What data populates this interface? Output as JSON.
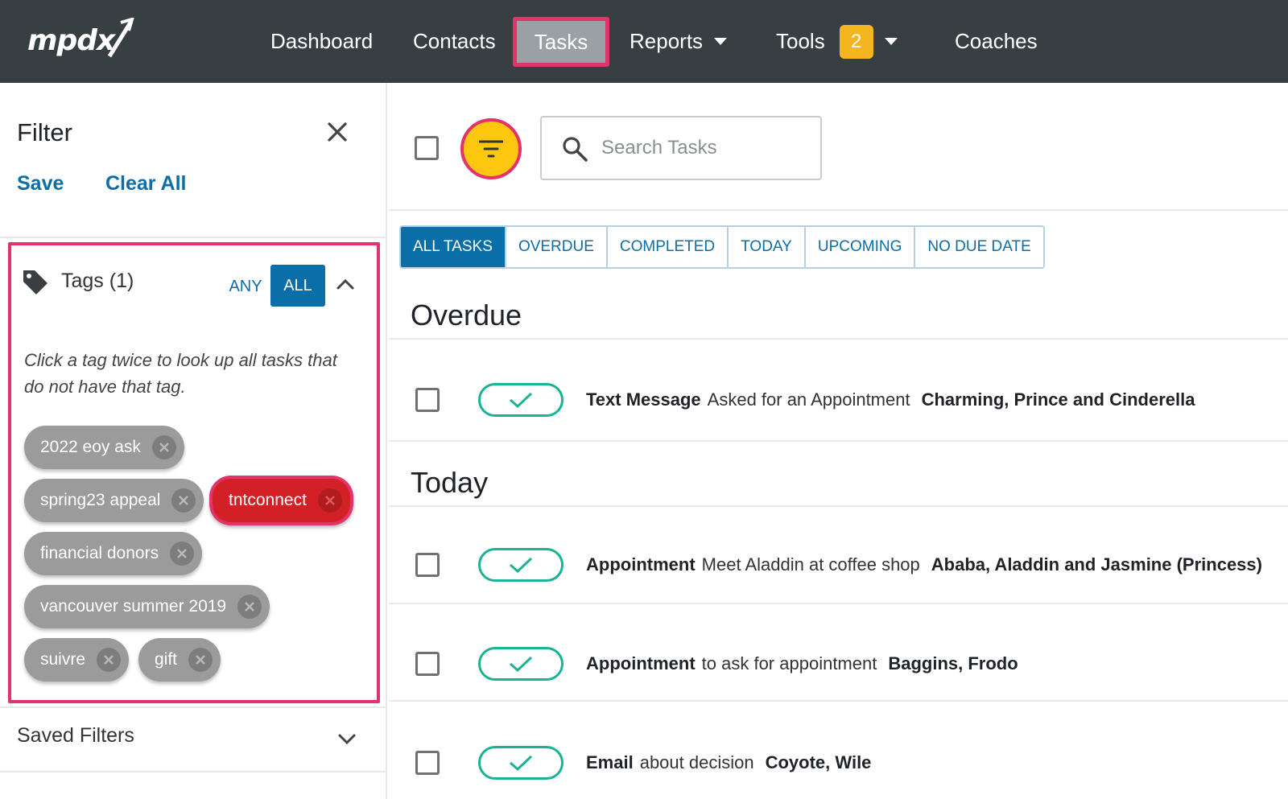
{
  "nav": {
    "logo_text": "mpdx",
    "items": [
      {
        "label": "Dashboard"
      },
      {
        "label": "Contacts"
      },
      {
        "label": "Tasks"
      },
      {
        "label": "Reports"
      },
      {
        "label": "Tools",
        "badge": "2"
      },
      {
        "label": "Coaches"
      }
    ],
    "active_item": "Tasks"
  },
  "sidebar": {
    "title": "Filter",
    "save_label": "Save",
    "clear_label": "Clear All",
    "tags": {
      "title": "Tags (1)",
      "any_label": "ANY",
      "all_label": "ALL",
      "selected_mode": "ALL",
      "hint": "Click a tag twice to look up all tasks that do not have that tag.",
      "chips": [
        {
          "label": "2022 eoy ask",
          "state": "neutral"
        },
        {
          "label": "spring23 appeal",
          "state": "neutral"
        },
        {
          "label": "tntconnect",
          "state": "excluded"
        },
        {
          "label": "financial donors",
          "state": "neutral"
        },
        {
          "label": "vancouver summer 2019",
          "state": "neutral"
        },
        {
          "label": "suivre",
          "state": "neutral"
        },
        {
          "label": "gift",
          "state": "neutral"
        }
      ]
    },
    "saved_filters_label": "Saved Filters"
  },
  "main": {
    "search": {
      "placeholder": "Search Tasks",
      "value": ""
    },
    "tabs": [
      {
        "label": "ALL TASKS",
        "active": true
      },
      {
        "label": "OVERDUE"
      },
      {
        "label": "COMPLETED"
      },
      {
        "label": "TODAY"
      },
      {
        "label": "UPCOMING"
      },
      {
        "label": "NO DUE DATE"
      }
    ],
    "sections": [
      {
        "heading": "Overdue",
        "tasks": [
          {
            "type": "Text Message",
            "subject": "Asked for an Appointment",
            "contact": "Charming, Prince and Cinderella"
          }
        ]
      },
      {
        "heading": "Today",
        "tasks": [
          {
            "type": "Appointment",
            "subject": "Meet Aladdin at coffee shop",
            "contact": "Ababa, Aladdin and Jasmine (Princess)"
          },
          {
            "type": "Appointment",
            "subject": "to ask for appointment",
            "contact": "Baggins, Frodo"
          },
          {
            "type": "Email",
            "subject": "about decision",
            "contact": "Coyote, Wile"
          }
        ]
      }
    ]
  },
  "colors": {
    "nav_bg": "#383f43",
    "accent_blue": "#0a6ea8",
    "highlight_pink": "#e2336b",
    "filter_yellow": "#fdc70f",
    "badge_yellow": "#f4b51e",
    "complete_green": "#1ab394",
    "excluded_red": "#d32027",
    "chip_gray": "#9b9b9b"
  }
}
